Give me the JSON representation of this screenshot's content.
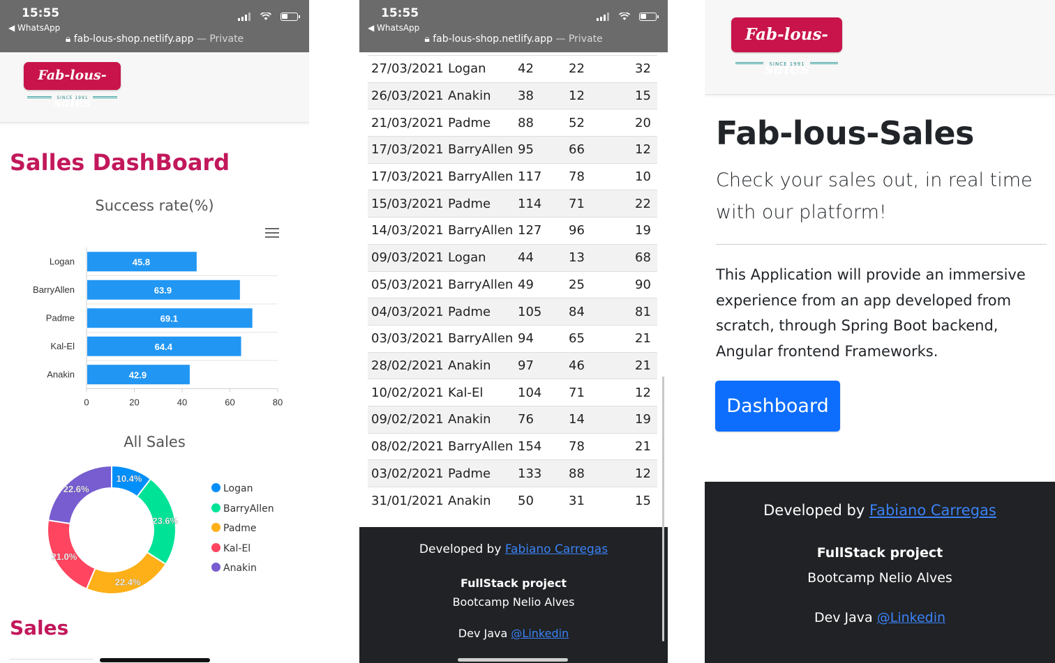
{
  "status": {
    "time": "15:55",
    "back_app": "◀ WhatsApp",
    "lock_icon": "lock-icon",
    "url": "fab-lous-shop.netlify.app",
    "private_label": "— Private"
  },
  "logo": {
    "text": "Fab-lous-sales",
    "since": "SINCE 1991",
    "brand_color": "#c8144a",
    "accent_color": "#2e8b8b"
  },
  "dashboard": {
    "title": "Salles DashBoard",
    "sales_title": "Sales"
  },
  "chart_data": [
    {
      "type": "bar",
      "orientation": "horizontal",
      "title": "Success rate(%)",
      "categories": [
        "Logan",
        "BarryAllen",
        "Padme",
        "Kal-El",
        "Anakin"
      ],
      "values": [
        45.8,
        63.9,
        69.1,
        64.4,
        42.9
      ],
      "xlim": [
        0,
        80
      ],
      "xticks": [
        0,
        20,
        40,
        60,
        80
      ],
      "bar_color": "#2196f3",
      "grid": true
    },
    {
      "type": "pie",
      "variant": "donut",
      "title": "All Sales",
      "labels": [
        "Logan",
        "BarryAllen",
        "Padme",
        "Kal-El",
        "Anakin"
      ],
      "values": [
        10.4,
        23.6,
        22.4,
        21.0,
        22.6
      ],
      "value_labels": [
        "10.4%",
        "23.6%",
        "22.4%",
        "21.0%",
        "22.6%"
      ],
      "colors": [
        "#008ffb",
        "#00e396",
        "#feb019",
        "#ff4560",
        "#775dd0"
      ],
      "legend": "right"
    }
  ],
  "table": {
    "rows": [
      [
        "27/03/2021",
        "Logan",
        "42",
        "22",
        "32"
      ],
      [
        "26/03/2021",
        "Anakin",
        "38",
        "12",
        "15"
      ],
      [
        "21/03/2021",
        "Padme",
        "88",
        "52",
        "20"
      ],
      [
        "17/03/2021",
        "BarryAllen",
        "95",
        "66",
        "12"
      ],
      [
        "17/03/2021",
        "BarryAllen",
        "117",
        "78",
        "10"
      ],
      [
        "15/03/2021",
        "Padme",
        "114",
        "71",
        "22"
      ],
      [
        "14/03/2021",
        "BarryAllen",
        "127",
        "96",
        "19"
      ],
      [
        "09/03/2021",
        "Logan",
        "44",
        "13",
        "68"
      ],
      [
        "05/03/2021",
        "BarryAllen",
        "49",
        "25",
        "90"
      ],
      [
        "04/03/2021",
        "Padme",
        "105",
        "84",
        "81"
      ],
      [
        "03/03/2021",
        "BarryAllen",
        "94",
        "65",
        "21"
      ],
      [
        "28/02/2021",
        "Anakin",
        "97",
        "46",
        "21"
      ],
      [
        "10/02/2021",
        "Kal-El",
        "104",
        "71",
        "12"
      ],
      [
        "09/02/2021",
        "Anakin",
        "76",
        "14",
        "19"
      ],
      [
        "08/02/2021",
        "BarryAllen",
        "154",
        "78",
        "21"
      ],
      [
        "03/02/2021",
        "Padme",
        "133",
        "88",
        "12"
      ],
      [
        "31/01/2021",
        "Anakin",
        "50",
        "31",
        "15"
      ]
    ]
  },
  "footer": {
    "developed_by": "Developed by",
    "author": "Fabiano Carregas",
    "project": "FullStack project",
    "bootcamp": "Bootcamp Nelio Alves",
    "dev_java": "Dev Java",
    "linkedin": "@Linkedin"
  },
  "home": {
    "title": "Fab-lous-Sales",
    "lead": "Check your sales out, in real time with our platform!",
    "description": "This Application will provide an immersive experience from an app developed from scratch, through Spring Boot backend, Angular frontend Frameworks.",
    "button": "Dashboard",
    "button_color": "#0d6efd"
  }
}
